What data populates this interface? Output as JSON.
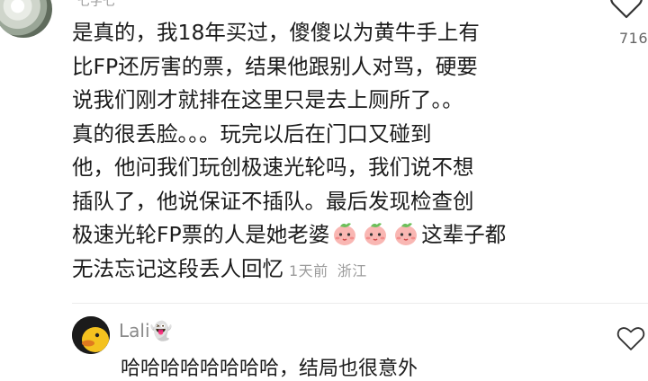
{
  "comment": {
    "username": "七字七",
    "lines": [
      "是真的，我18年买过，傻傻以为黄牛手上有",
      "比FP还厉害的票，结果他跟别人对骂，硬要",
      "说我们刚才就排在这里只是去上厕所了。。",
      "真的很丢脸。。。玩完以后在门口又碰到",
      "他，他问我们玩创极速光轮吗，我们说不想",
      "插队了，他说保证不插队。最后发现检查创",
      "极速光轮FP票的人是她老婆",
      "这辈子都",
      "无法忘记这段丢人回忆"
    ],
    "emoji_name": "peach-face-emoji",
    "time": "1天前",
    "location": "浙江",
    "like_count": "716",
    "like_icon": "heart-outline-icon"
  },
  "reply": {
    "username": "Lali",
    "username_emoji": "👻",
    "preview_text": "哈哈哈哈哈哈哈哈，结局也很意外",
    "like_icon": "heart-outline-icon"
  },
  "colors": {
    "text": "#1b1b1b",
    "meta": "#9b9b9b",
    "emoji_pink": "#f7a8a8",
    "emoji_green": "#7cc36b"
  }
}
